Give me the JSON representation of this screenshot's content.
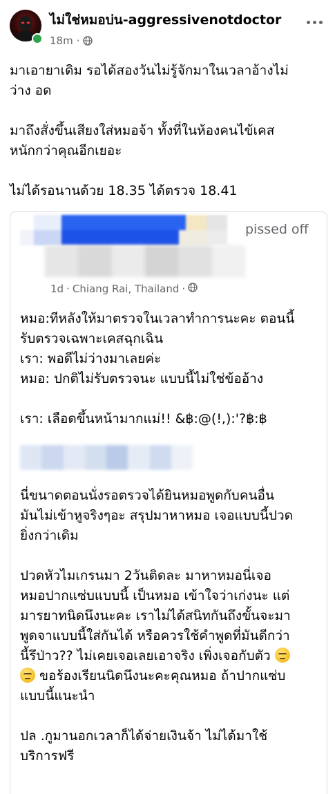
{
  "post": {
    "author": "ไม่ใช่หมอบ่น-aggressivenotdoctor",
    "time": "18m",
    "privacy_icon": "globe-icon",
    "more_icon": "more-dots-icon",
    "paragraphs": [
      "มาเอายาเดิม รอได้สองวันไม่รู้จักมาในเวลาอ้างไม่\nว่าง อด",
      "มาถึงสั่งขึ้นเสียงใส่หมอจ้า ทั้งที่ในห้องคนไข้เคส\nหนักกว่าคุณอีกเยอะ",
      "ไม่ได้รอนานด้วย 18.35 ได้ตรวจ 18.41"
    ]
  },
  "shared": {
    "feeling_fragment": "pissed off",
    "time": "1d",
    "location": "Chiang Rai, Thailand",
    "privacy_icon": "globe-icon",
    "block1": [
      "หมอ:ทีหลังให้มาตรวจในเวลาทำการนะคะ ตอนนี้",
      "รับตรวจเฉพาะเคสฉุกเฉิน",
      "เรา: พอดีไม่ว่างมาเลยค่ะ",
      "หมอ: ปกติไม่รับตรวจนะ แบบนี้ไม่ใช่ข้ออ้าง"
    ],
    "block2": "เรา: เลือดขึ้นหน้ามากแม่!! &฿:@(!,):'?฿:฿",
    "block3": [
      "นี่ขนาดตอนนั่งรอตรวจได้ยินหมอพูดกับคนอื่น",
      "มันไม่เข้าหูจริงๆอะ สรุปมาหาหมอ เจอแบบนี้ปวด",
      "ยิ่งกว่าเดิม"
    ],
    "block4": [
      "ปวดหัวไมเกรนมา 2วันติดละ  มาหาหมอนี่เจอ",
      "หมอปากแซ่บแบบนี้ เป็นหมอ เข้าใจว่าเก่งนะ แต่",
      "มารยาทนิดนึงนะคะ เราไม่ได้สนิทกันถึงขั้นจะมา",
      "พูดจาแบบนี้ใส่กันได้ หรือควรใช้คำพูดที่มันดีกว่า",
      "นี้รึป่าว?? ไม่เคยเจอเลยเอาจริง เพิ่งเจอกับตัว"
    ],
    "block4_cont": "ขอร้องเรียนนิดนึงนะคะคุณหมอ ถ้าปากแซ่บ",
    "block4_last": "แบบนี้แนะนำ",
    "block5": [
      "ปล .กูมานอกเวลาก็ได้จ่ายเงินจ้า ไม่ได้มาใช้",
      "บริการฟรี"
    ],
    "emoji_icon": "rolling-eyes-emoji"
  }
}
